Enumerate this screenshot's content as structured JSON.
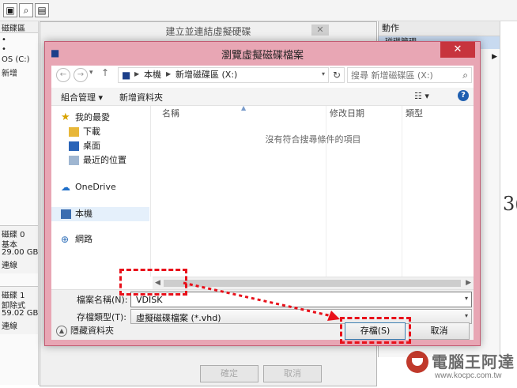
{
  "background": {
    "left_header": "磁碟區",
    "left_volume_c": "OS (C:)",
    "left_volume_new": "新增",
    "disk0": {
      "name": "磁碟 0",
      "type": "基本",
      "size": "29.00 GB",
      "status": "連線"
    },
    "disk1": {
      "name": "磁碟 1",
      "type": "卸除式",
      "size": "59.02 GB",
      "status": "連線"
    },
    "actions_header": "動作",
    "actions_item": "磁碟管理",
    "parent_dialog_title": "建立並連結虛擬硬碟",
    "parent_ok": "確定",
    "parent_cancel": "取消",
    "right_glyph": "3("
  },
  "dialog": {
    "title": "瀏覽虛擬磁碟檔案",
    "close_glyph": "✕",
    "breadcrumb": [
      "本機",
      "新增磁碟區 (X:)"
    ],
    "search_placeholder": "搜尋 新增磁碟區 (X:)",
    "toolbar": {
      "organize": "組合管理 ▾",
      "new_folder": "新增資料夾"
    },
    "nav": {
      "favorites": "我的最愛",
      "downloads": "下載",
      "desktop": "桌面",
      "recent": "最近的位置",
      "onedrive": "OneDrive",
      "this_pc": "本機",
      "network": "網路"
    },
    "columns": {
      "name": "名稱",
      "modified": "修改日期",
      "type": "類型"
    },
    "empty_message": "沒有符合搜尋條件的項目",
    "filename_label": "檔案名稱(N):",
    "filename_value": "VDISK",
    "filetype_label": "存檔類型(T):",
    "filetype_value": "虛擬磁碟檔案 (*.vhd)",
    "hide_folders": "隱藏資料夾",
    "save_button": "存檔(S)",
    "cancel_button": "取消"
  },
  "watermark": {
    "title": "電腦王阿達",
    "url": "www.kocpc.com.tw"
  },
  "colors": {
    "highlight": "#e8101a",
    "frame": "#e8a6b4",
    "close": "#c7343d"
  }
}
